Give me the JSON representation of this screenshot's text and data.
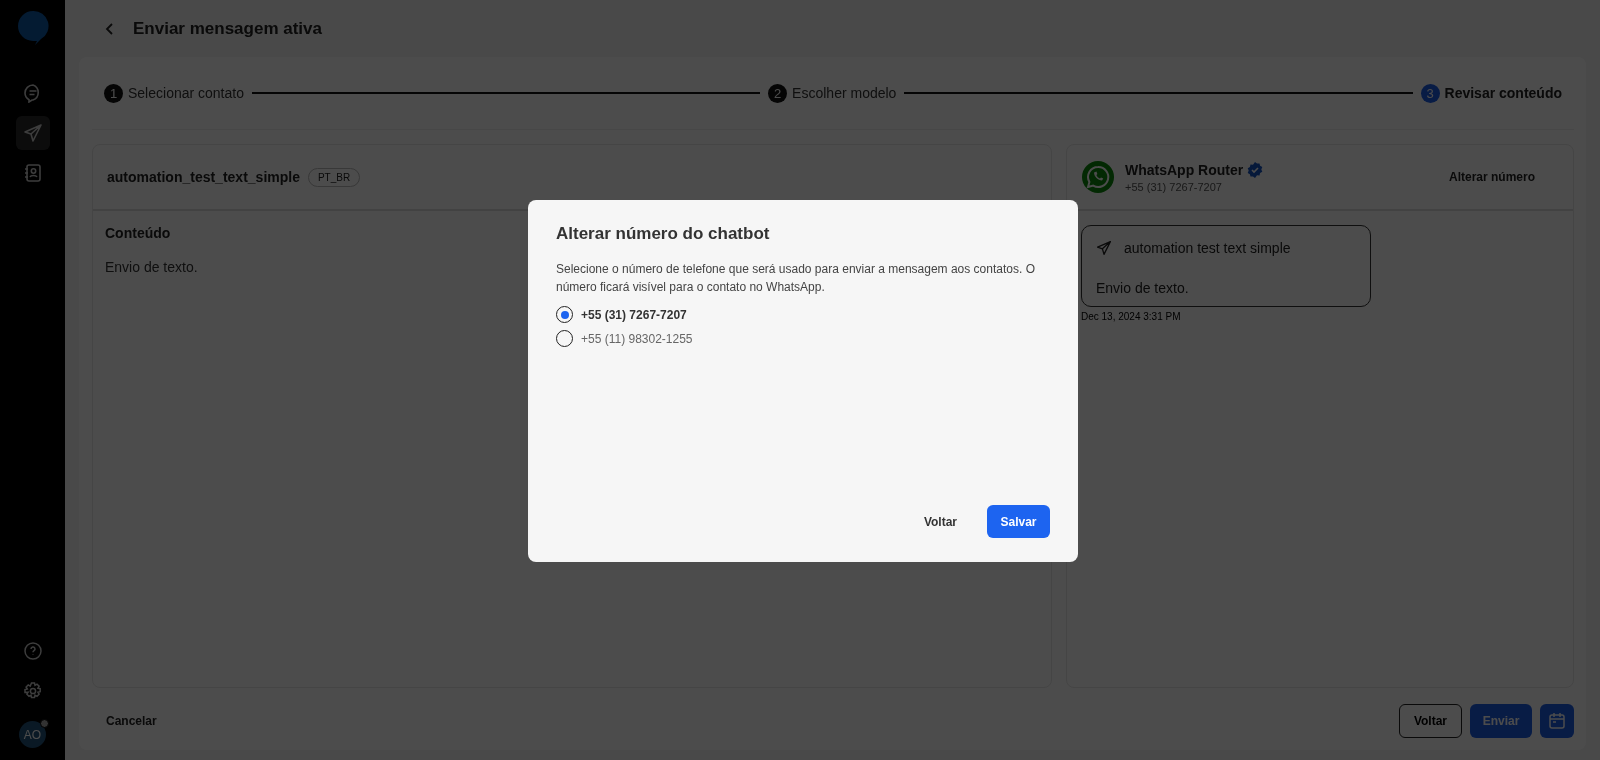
{
  "sidebar": {
    "nav": [
      {
        "selected": false
      },
      {
        "selected": true
      },
      {
        "selected": false
      }
    ],
    "avatar": {
      "initials": "AO"
    }
  },
  "header": {
    "title": "Enviar mensagem ativa"
  },
  "steps": [
    {
      "number": "1",
      "label": "Selecionar contato",
      "selected": false
    },
    {
      "number": "2",
      "label": "Escolher modelo",
      "selected": false
    },
    {
      "number": "3",
      "label": "Revisar conteúdo",
      "selected": true
    }
  ],
  "template": {
    "name": "automation_test_text_simple",
    "language": "PT_BR",
    "content_heading": "Conteúdo",
    "content": "Envio de texto."
  },
  "preview": {
    "sender": "WhatsApp Router",
    "verified": true,
    "phone": "+55 (31) 7267-7207",
    "change_link": "Alterar número",
    "bubble_title": "automation test text simple",
    "bubble_text": "Envio de texto.",
    "timestamp": "Dec 13, 2024 3:31 PM"
  },
  "footer": {
    "cancel": "Cancelar",
    "back": "Voltar",
    "send": "Enviar"
  },
  "modal": {
    "title": "Alterar número do chatbot",
    "description": "Selecione o número de telefone que será usado para enviar a mensagem aos contatos. O número ficará visível para o contato no WhatsApp.",
    "options": [
      {
        "label": "+55 (31) 7267-7207",
        "selected": true
      },
      {
        "label": "+55 (11) 98302-1255",
        "selected": false
      }
    ],
    "back": "Voltar",
    "save": "Salvar"
  }
}
